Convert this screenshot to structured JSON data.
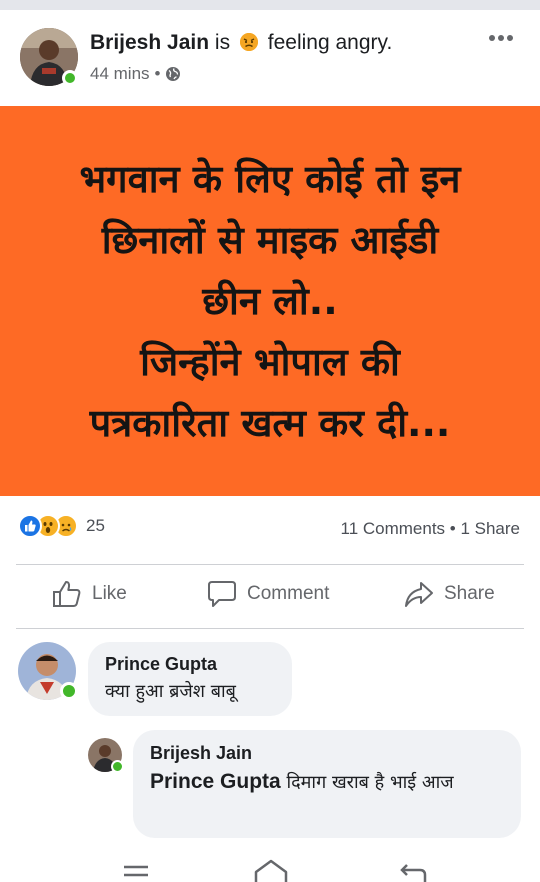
{
  "post": {
    "author": "Brijesh Jain",
    "status_is": "is",
    "feeling": "feeling angry.",
    "feeling_icon": "angry-face-emoji",
    "time": "44 mins",
    "separator": "•",
    "audience_icon": "globe-icon",
    "more_icon": "more-options-icon",
    "image_text": "भगवान के लिए कोई तो इन\nछिनालों से माइक आईडी\nछीन लो..\nजिन्होंने भोपाल की\nपत्रकारिता खत्म कर दी...",
    "image_bg": "#fe6a25"
  },
  "stats": {
    "reaction_icons": [
      "like-reaction",
      "wow-reaction",
      "sad-reaction"
    ],
    "reaction_count": "25",
    "comments_shares": "11 Comments • 1 Share"
  },
  "actions": {
    "like": "Like",
    "comment": "Comment",
    "share": "Share"
  },
  "comments": [
    {
      "name": "Prince Gupta",
      "text": "क्या हुआ ब्रजेश बाबू"
    },
    {
      "name": "Brijesh Jain",
      "mention": "Prince Gupta",
      "text": "दिमाग खराब है भाई आज"
    }
  ],
  "nav": {
    "icons": [
      "menu-icon",
      "home-icon",
      "back-icon"
    ]
  },
  "colors": {
    "facebook_blue": "#1b74e4",
    "online_green": "#42b72a",
    "meta_gray": "#65676b"
  }
}
